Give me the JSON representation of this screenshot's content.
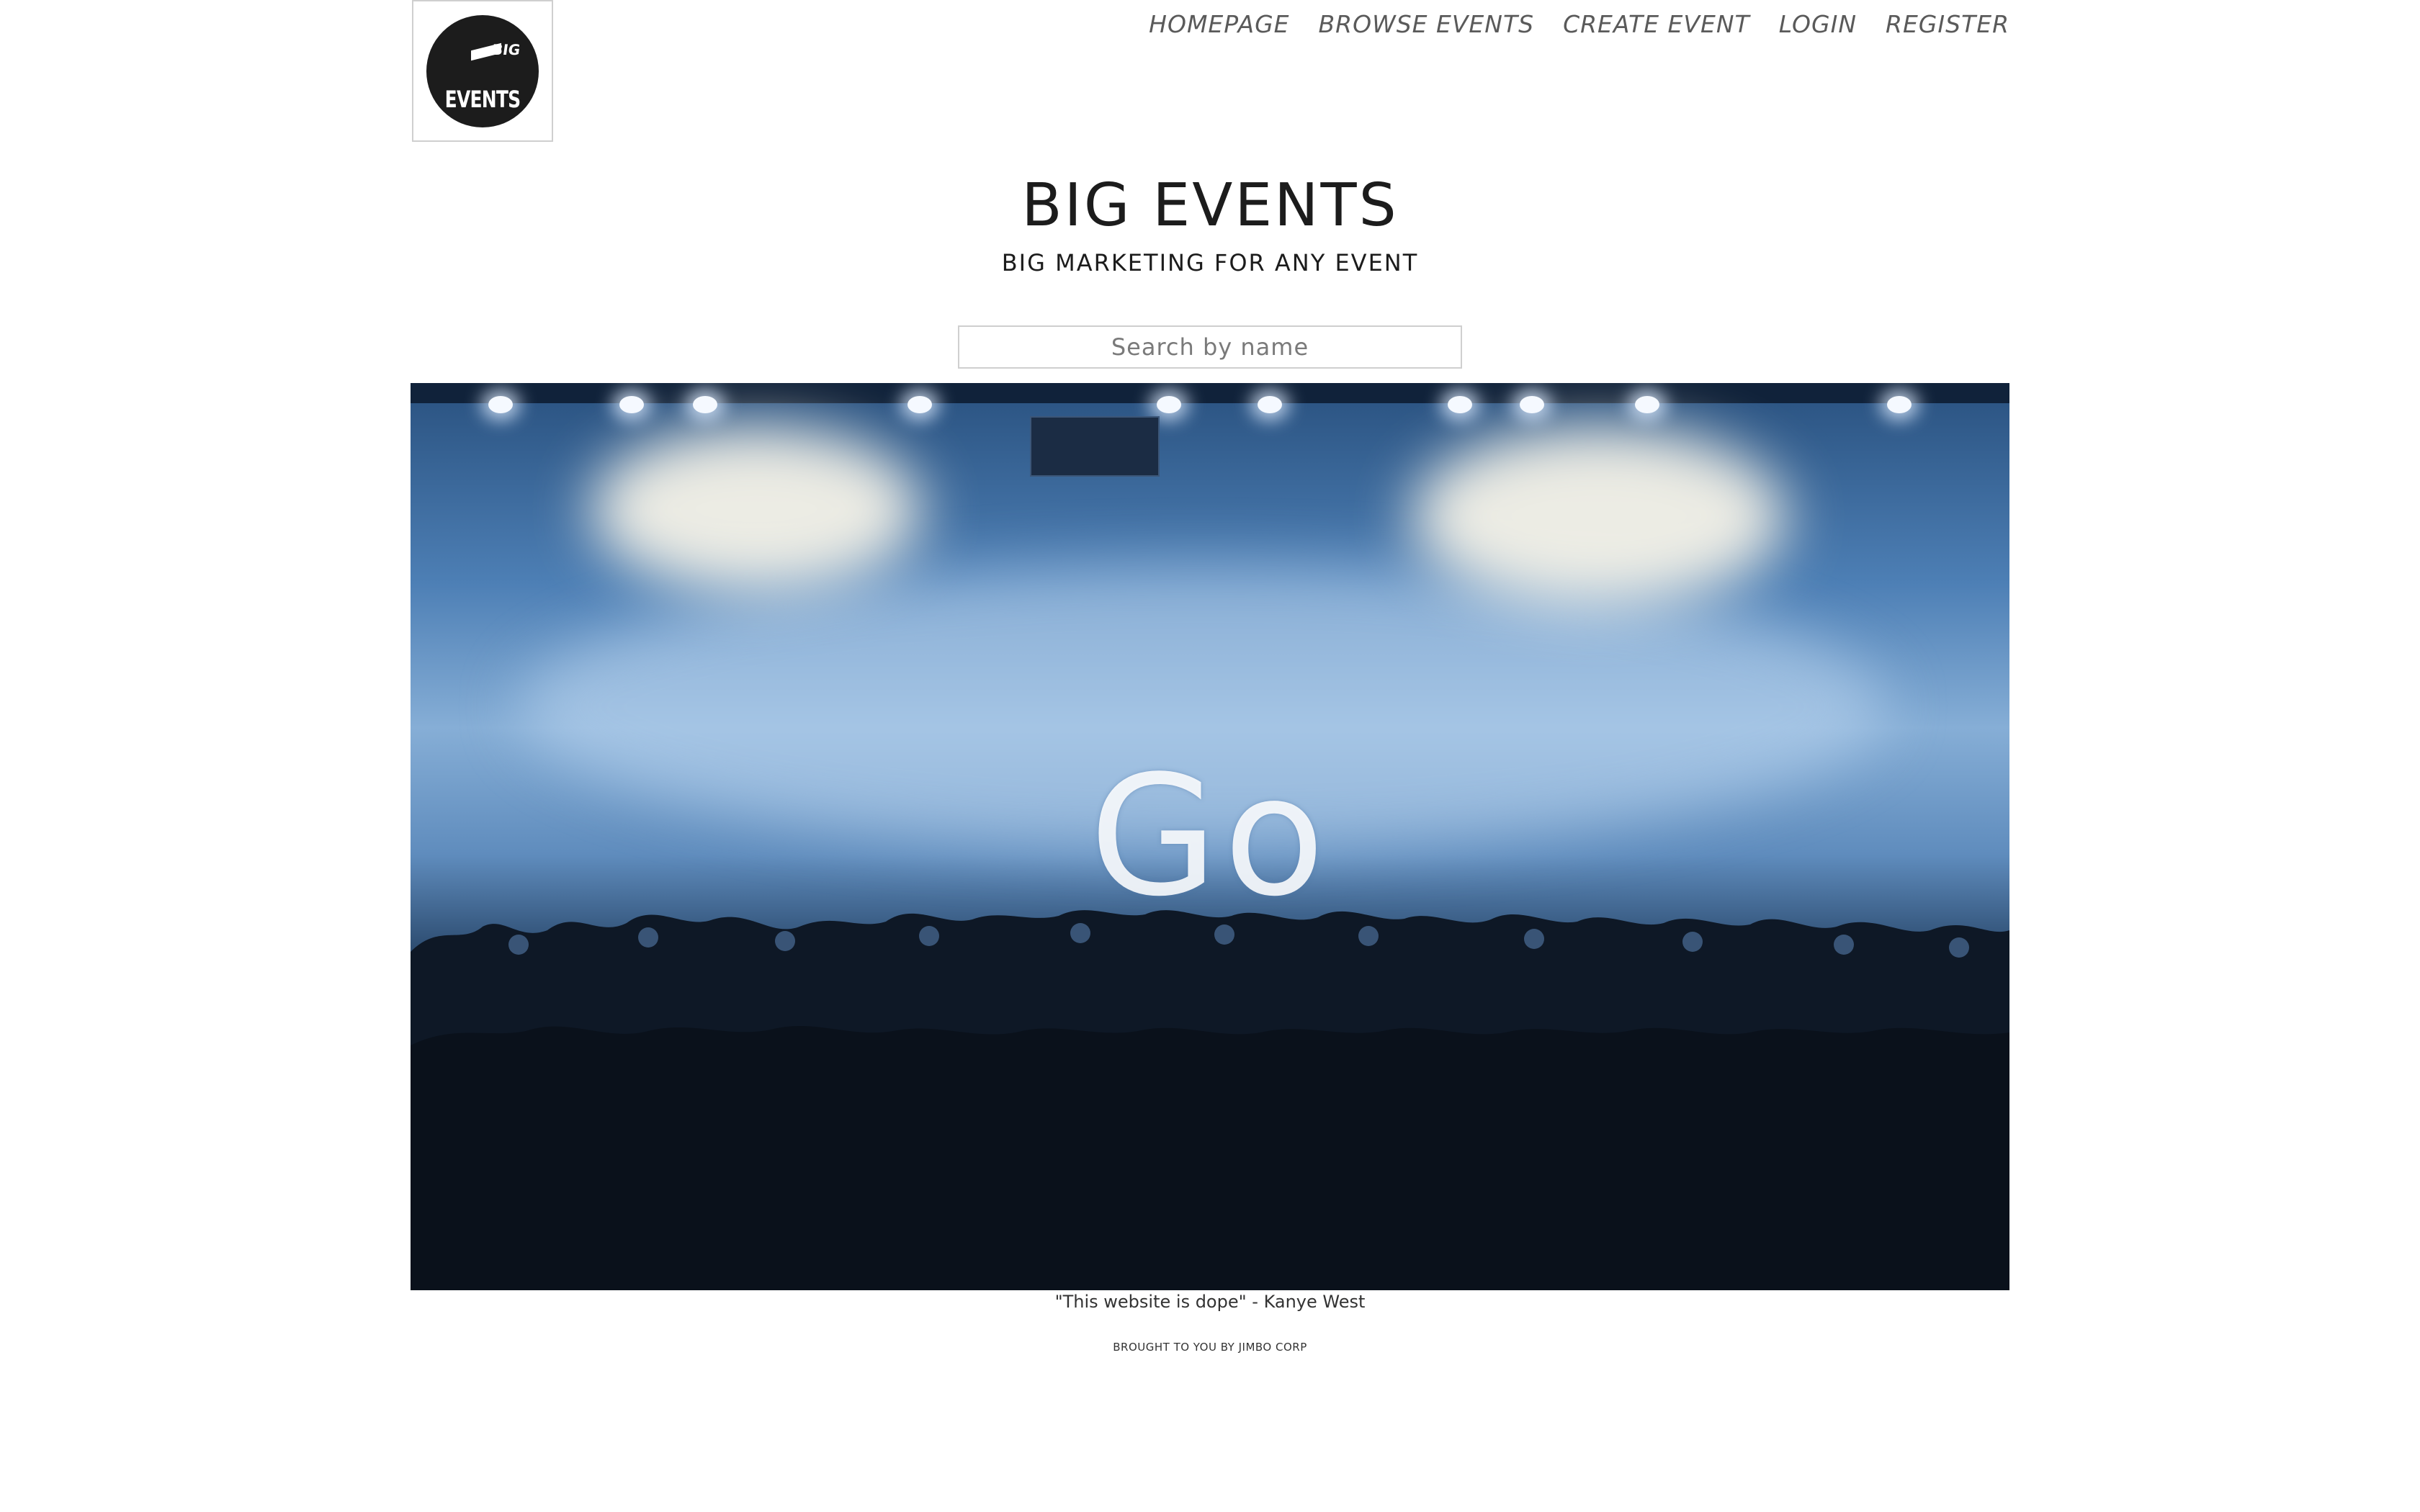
{
  "logo": {
    "top_text": "BIG",
    "main_text": "EVENTS"
  },
  "nav": {
    "items": [
      {
        "label": "HOMEPAGE"
      },
      {
        "label": "BROWSE EVENTS"
      },
      {
        "label": "CREATE EVENT"
      },
      {
        "label": "LOGIN"
      },
      {
        "label": "REGISTER"
      }
    ]
  },
  "header": {
    "title": "BIG EVENTS",
    "subtitle": "BIG MARKETING FOR ANY EVENT"
  },
  "search": {
    "placeholder": "Search by name",
    "value": ""
  },
  "hero": {
    "button_label": "Go"
  },
  "footer": {
    "quote": "\"This website is dope\" - Kanye West",
    "credit": "BROUGHT TO YOU BY JIMBO CORP"
  },
  "colors": {
    "background": "#ffffff",
    "nav_text": "#5a5a5a",
    "title_text": "#1c1c1c",
    "hero_blue": "#4d7fb5"
  }
}
